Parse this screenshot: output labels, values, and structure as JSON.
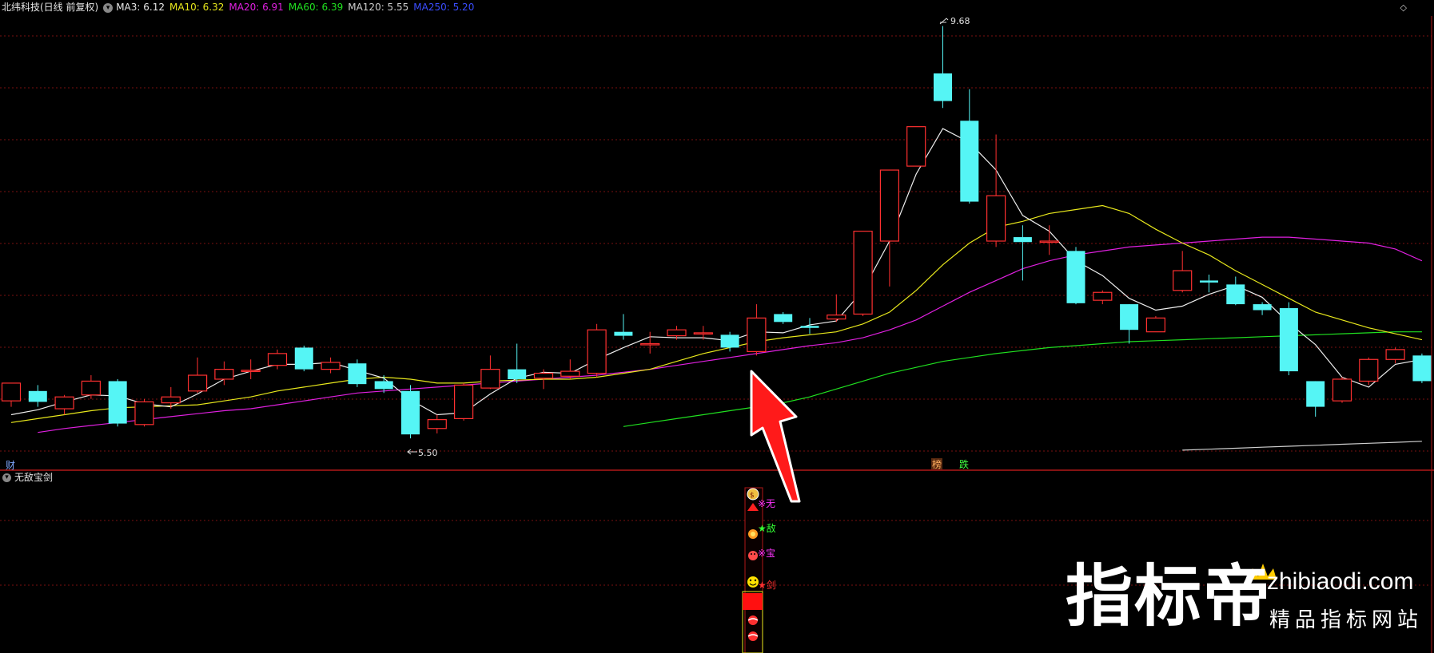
{
  "header": {
    "stock_title": "北纬科技(日线 前复权)",
    "toggle_glyph": "▾",
    "ma_indicators": [
      {
        "label": "MA3: 6.12",
        "color": "#e8e8e8"
      },
      {
        "label": "MA10: 6.32",
        "color": "#e8e81c"
      },
      {
        "label": "MA20: 6.91",
        "color": "#e020e0"
      },
      {
        "label": "MA60: 6.39",
        "color": "#20e020"
      },
      {
        "label": "MA120: 5.55",
        "color": "#cfcfcf"
      },
      {
        "label": "MA250: 5.20",
        "color": "#3a4dff"
      }
    ],
    "collapse_glyph": "◇"
  },
  "main_chart": {
    "high_label": "9.68",
    "low_label": "5.50",
    "cai_label": "财",
    "tag_bang": "榜",
    "tag_die": "跌",
    "colors": {
      "up": "#ff3030",
      "down": "#55f5f5",
      "grid": "#7a0f0f",
      "border": "#b01818"
    },
    "candles": [
      [
        5.88,
        6.06,
        5.82,
        6.02
      ],
      [
        5.98,
        5.87,
        5.82,
        6.04
      ],
      [
        5.8,
        5.92,
        5.74,
        5.94
      ],
      [
        5.94,
        6.08,
        5.9,
        6.14
      ],
      [
        6.08,
        5.65,
        5.62,
        6.1
      ],
      [
        5.64,
        5.87,
        5.62,
        5.9
      ],
      [
        5.86,
        5.92,
        5.8,
        6.02
      ],
      [
        5.98,
        6.14,
        5.96,
        6.32
      ],
      [
        6.1,
        6.2,
        6.04,
        6.28
      ],
      [
        6.19,
        6.19,
        6.1,
        6.3
      ],
      [
        6.24,
        6.36,
        6.2,
        6.4
      ],
      [
        6.42,
        6.2,
        6.18,
        6.44
      ],
      [
        6.2,
        6.27,
        6.16,
        6.32
      ],
      [
        6.26,
        6.05,
        6.02,
        6.3
      ],
      [
        6.08,
        6.0,
        5.96,
        6.14
      ],
      [
        5.98,
        5.54,
        5.5,
        6.04
      ],
      [
        5.6,
        5.69,
        5.55,
        5.74
      ],
      [
        5.7,
        6.04,
        5.68,
        6.06
      ],
      [
        6.01,
        6.2,
        6.0,
        6.34
      ],
      [
        6.2,
        6.1,
        6.06,
        6.46
      ],
      [
        6.11,
        6.16,
        6.0,
        6.2
      ],
      [
        6.13,
        6.18,
        6.1,
        6.3
      ],
      [
        6.16,
        6.6,
        6.12,
        6.66
      ],
      [
        6.58,
        6.54,
        6.5,
        6.76
      ],
      [
        6.46,
        6.46,
        6.36,
        6.58
      ],
      [
        6.54,
        6.6,
        6.5,
        6.64
      ],
      [
        6.57,
        6.57,
        6.5,
        6.64
      ],
      [
        6.55,
        6.42,
        6.38,
        6.58
      ],
      [
        6.38,
        6.72,
        6.34,
        6.86
      ],
      [
        6.76,
        6.68,
        6.66,
        6.78
      ],
      [
        6.64,
        6.62,
        6.56,
        6.72
      ],
      [
        6.71,
        6.75,
        6.68,
        6.96
      ],
      [
        6.76,
        7.6,
        6.74,
        7.6
      ],
      [
        7.5,
        8.22,
        7.04,
        8.22
      ],
      [
        8.26,
        8.66,
        8.34,
        8.66
      ],
      [
        9.2,
        8.92,
        8.85,
        9.68
      ],
      [
        8.72,
        7.9,
        7.88,
        9.04
      ],
      [
        7.5,
        7.96,
        7.44,
        8.58
      ],
      [
        7.54,
        7.49,
        7.1,
        7.66
      ],
      [
        7.5,
        7.5,
        7.36,
        7.66
      ],
      [
        7.4,
        6.87,
        6.86,
        7.44
      ],
      [
        6.9,
        6.98,
        6.86,
        7.0
      ],
      [
        6.86,
        6.6,
        6.46,
        6.86
      ],
      [
        6.58,
        6.72,
        6.58,
        6.74
      ],
      [
        7.0,
        7.2,
        6.98,
        7.4
      ],
      [
        7.1,
        7.08,
        6.98,
        7.16
      ],
      [
        7.06,
        6.86,
        6.85,
        7.14
      ],
      [
        6.86,
        6.8,
        6.75,
        6.88
      ],
      [
        6.82,
        6.18,
        6.14,
        6.88
      ],
      [
        6.08,
        5.82,
        5.72,
        6.08
      ],
      [
        5.88,
        6.1,
        5.86,
        6.12
      ],
      [
        6.08,
        6.3,
        6.04,
        6.32
      ],
      [
        6.3,
        6.4,
        6.26,
        6.42
      ],
      [
        6.34,
        6.08,
        6.06,
        6.36
      ]
    ],
    "ma3": [
      5.74,
      5.79,
      5.87,
      5.94,
      5.93,
      5.85,
      5.82,
      5.95,
      6.1,
      6.18,
      6.25,
      6.25,
      6.27,
      6.19,
      6.11,
      5.89,
      5.74,
      5.76,
      5.95,
      6.11,
      6.17,
      6.16,
      6.3,
      6.42,
      6.53,
      6.52,
      6.52,
      6.49,
      6.58,
      6.57,
      6.65,
      6.69,
      7.0,
      7.5,
      8.18,
      8.64,
      8.5,
      8.22,
      7.76,
      7.6,
      7.3,
      7.15,
      6.92,
      6.8,
      6.84,
      6.96,
      7.05,
      6.93,
      6.67,
      6.45,
      6.12,
      6.02,
      6.25,
      6.3
    ],
    "ma10": [
      5.66,
      5.7,
      5.74,
      5.78,
      5.81,
      5.82,
      5.83,
      5.84,
      5.88,
      5.92,
      5.98,
      6.02,
      6.06,
      6.1,
      6.12,
      6.1,
      6.06,
      6.06,
      6.08,
      6.09,
      6.1,
      6.1,
      6.12,
      6.16,
      6.2,
      6.28,
      6.36,
      6.42,
      6.48,
      6.52,
      6.55,
      6.58,
      6.66,
      6.78,
      7.0,
      7.26,
      7.48,
      7.64,
      7.7,
      7.78,
      7.82,
      7.86,
      7.78,
      7.62,
      7.48,
      7.36,
      7.2,
      7.06,
      6.92,
      6.78,
      6.7,
      6.62,
      6.56,
      6.5
    ],
    "ma20": [
      null,
      5.56,
      5.6,
      5.63,
      5.66,
      5.69,
      5.72,
      5.75,
      5.78,
      5.8,
      5.84,
      5.88,
      5.92,
      5.96,
      5.98,
      6.0,
      6.02,
      6.04,
      6.06,
      6.08,
      6.1,
      6.12,
      6.14,
      6.17,
      6.2,
      6.24,
      6.28,
      6.32,
      6.36,
      6.4,
      6.44,
      6.47,
      6.52,
      6.6,
      6.7,
      6.84,
      6.98,
      7.1,
      7.22,
      7.3,
      7.36,
      7.4,
      7.44,
      7.46,
      7.48,
      7.5,
      7.52,
      7.54,
      7.54,
      7.52,
      7.5,
      7.48,
      7.42,
      7.3
    ],
    "ma60": [
      null,
      null,
      null,
      null,
      null,
      null,
      null,
      null,
      null,
      null,
      null,
      null,
      null,
      null,
      null,
      null,
      null,
      null,
      null,
      null,
      null,
      null,
      null,
      5.62,
      5.66,
      5.7,
      5.74,
      5.78,
      5.82,
      5.86,
      5.92,
      6.0,
      6.08,
      6.16,
      6.22,
      6.28,
      6.32,
      6.36,
      6.39,
      6.42,
      6.44,
      6.46,
      6.48,
      6.49,
      6.5,
      6.51,
      6.52,
      6.53,
      6.54,
      6.55,
      6.56,
      6.57,
      6.58,
      6.58
    ],
    "ma120": [
      null,
      null,
      null,
      null,
      null,
      null,
      null,
      null,
      null,
      null,
      null,
      null,
      null,
      null,
      null,
      null,
      null,
      null,
      null,
      null,
      null,
      null,
      null,
      null,
      null,
      null,
      null,
      null,
      null,
      null,
      null,
      null,
      null,
      null,
      null,
      null,
      null,
      null,
      null,
      null,
      null,
      null,
      null,
      null,
      5.38,
      5.39,
      5.4,
      5.41,
      5.42,
      5.43,
      5.44,
      5.45,
      5.46,
      5.47
    ]
  },
  "sub_chart": {
    "title": "无敌宝剑",
    "toggle_glyph": "▾",
    "labels": [
      {
        "text": "※无",
        "color": "#ff33ff"
      },
      {
        "text": "★敌",
        "color": "#33ff33"
      },
      {
        "text": "※宝",
        "color": "#ff33ff"
      },
      {
        "text": "★剑",
        "color": "#ff3030"
      }
    ]
  },
  "watermark": {
    "brand": "指标帝",
    "domain": "zhibiaodi.com",
    "slogan": "精品指标网站"
  }
}
